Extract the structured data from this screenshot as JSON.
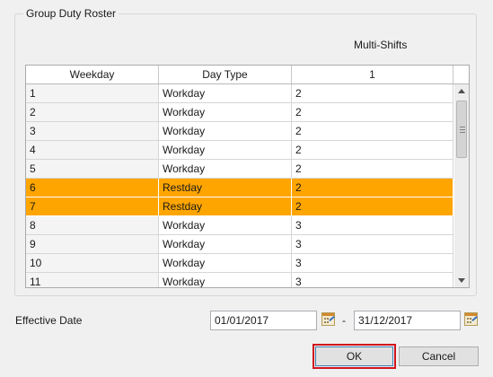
{
  "group": {
    "title": "Group Duty Roster",
    "multishift_title": "Multi-Shifts"
  },
  "grid": {
    "columns": [
      "Weekday",
      "Day Type",
      "1"
    ],
    "rows": [
      {
        "weekday": "1",
        "daytype": "Workday",
        "shift": "2",
        "highlight": false
      },
      {
        "weekday": "2",
        "daytype": "Workday",
        "shift": "2",
        "highlight": false
      },
      {
        "weekday": "3",
        "daytype": "Workday",
        "shift": "2",
        "highlight": false
      },
      {
        "weekday": "4",
        "daytype": "Workday",
        "shift": "2",
        "highlight": false
      },
      {
        "weekday": "5",
        "daytype": "Workday",
        "shift": "2",
        "highlight": false
      },
      {
        "weekday": "6",
        "daytype": "Restday",
        "shift": "2",
        "highlight": true
      },
      {
        "weekday": "7",
        "daytype": "Restday",
        "shift": "2",
        "highlight": true
      },
      {
        "weekday": "8",
        "daytype": "Workday",
        "shift": "3",
        "highlight": false
      },
      {
        "weekday": "9",
        "daytype": "Workday",
        "shift": "3",
        "highlight": false
      },
      {
        "weekday": "10",
        "daytype": "Workday",
        "shift": "3",
        "highlight": false
      },
      {
        "weekday": "11",
        "daytype": "Workday",
        "shift": "3",
        "highlight": false
      }
    ],
    "highlight_color": "#ffa500"
  },
  "effective": {
    "label": "Effective Date",
    "from": "01/01/2017",
    "separator": "-",
    "to": "31/12/2017",
    "calendar_icon": "calendar-icon"
  },
  "buttons": {
    "ok": "OK",
    "cancel": "Cancel"
  }
}
